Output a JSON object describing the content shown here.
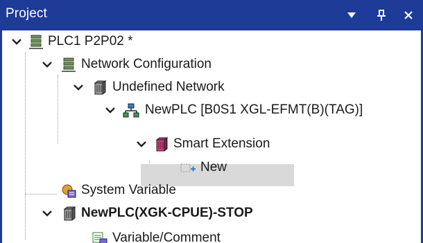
{
  "panel": {
    "title": "Project",
    "controls": {
      "dropdown_icon": "chevron-down-icon",
      "pin_icon": "pin-icon",
      "close_icon": "close-icon"
    }
  },
  "tree": {
    "plc_root": {
      "label": "PLC1 P2P02 *",
      "icon": "network-project-icon",
      "expanded": true
    },
    "network_configuration": {
      "label": "Network Configuration",
      "icon": "network-project-icon",
      "expanded": true
    },
    "undefined_network": {
      "label": "Undefined Network",
      "icon": "module-icon",
      "expanded": true
    },
    "newplc_node": {
      "label": "NewPLC [B0S1 XGL-EFMT(B)(TAG)]",
      "icon": "network-node-icon",
      "expanded": true
    },
    "smart_extension": {
      "label": "Smart Extension",
      "icon": "smart-extension-icon",
      "expanded": true,
      "selected": true
    },
    "new_item": {
      "label": "New",
      "icon": "add-new-icon"
    },
    "system_variable": {
      "label": "System Variable",
      "icon": "system-variable-icon"
    },
    "newplc_cpu": {
      "label": "NewPLC(XGK-CPUE)-STOP",
      "icon": "module-icon",
      "expanded": true,
      "bold": true
    },
    "variable_comment": {
      "label": "Variable/Comment",
      "icon": "variable-comment-icon"
    }
  },
  "colors": {
    "titlebar": "#1e3b98",
    "selection": "#d9d9d9",
    "text": "#1a1a1a"
  }
}
